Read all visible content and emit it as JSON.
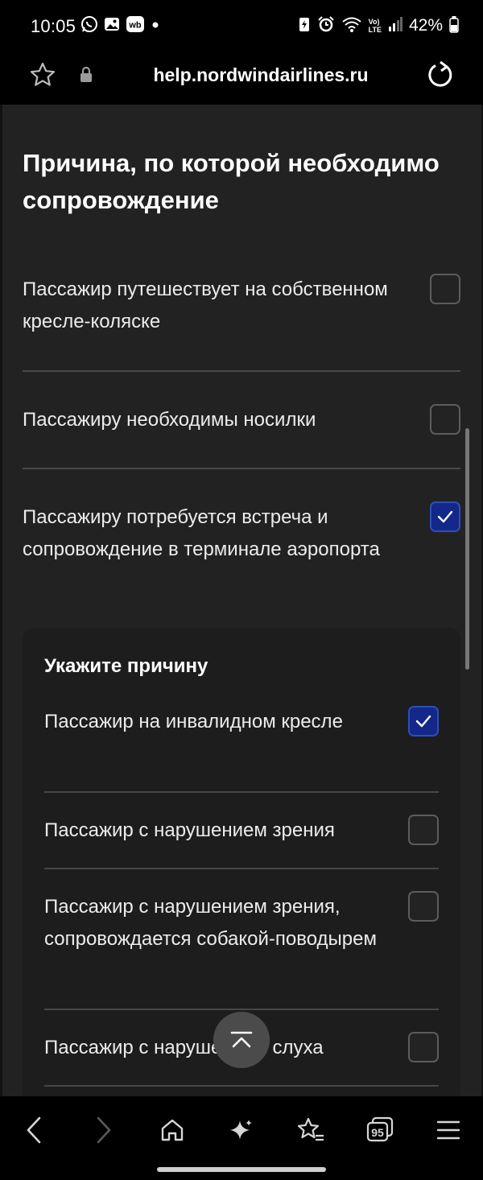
{
  "status_bar": {
    "time": "10:05",
    "battery": "42%",
    "left_icons": [
      "whatsapp-icon",
      "gallery-icon",
      "wb-app-icon",
      "dot-icon"
    ],
    "right_icons": [
      "battery-saver-icon",
      "alarm-icon",
      "wifi-icon",
      "volte-icon",
      "signal-icon",
      "battery-icon"
    ],
    "wb_label": "wb",
    "volte_label_top": "Vo)",
    "volte_label_bottom": "LTE"
  },
  "browser": {
    "url": "help.nordwindairlines.ru"
  },
  "page": {
    "section_title": "Причина, по которой необходимо сопровождение",
    "options": [
      {
        "label": "Пассажир путешествует на собственном кресле-коляске",
        "checked": false
      },
      {
        "label": "Пассажиру необходимы носилки",
        "checked": false
      },
      {
        "label": "Пассажиру потребуется встреча и сопровождение в терминале аэропорта",
        "checked": true
      }
    ],
    "reason_panel": {
      "title": "Укажите причину",
      "options": [
        {
          "label": "Пассажир на инвалидном кресле",
          "checked": true
        },
        {
          "label": "Пассажир с нарушением зрения",
          "checked": false
        },
        {
          "label": "Пассажир с нарушением зрения, сопровождается собакой-поводырем",
          "checked": false
        },
        {
          "label": "Пассажир с нарушением слуха",
          "checked": false
        }
      ]
    }
  },
  "bottom_nav": {
    "tabs_count": "95",
    "items": [
      "back-icon",
      "forward-icon",
      "home-icon",
      "ai-sparkle-icon",
      "bookmarks-icon",
      "tabs-icon",
      "menu-icon"
    ]
  },
  "colors": {
    "page_bg": "#222222",
    "checkbox_checked": "#13288a",
    "checkmark": "#ffffff"
  }
}
